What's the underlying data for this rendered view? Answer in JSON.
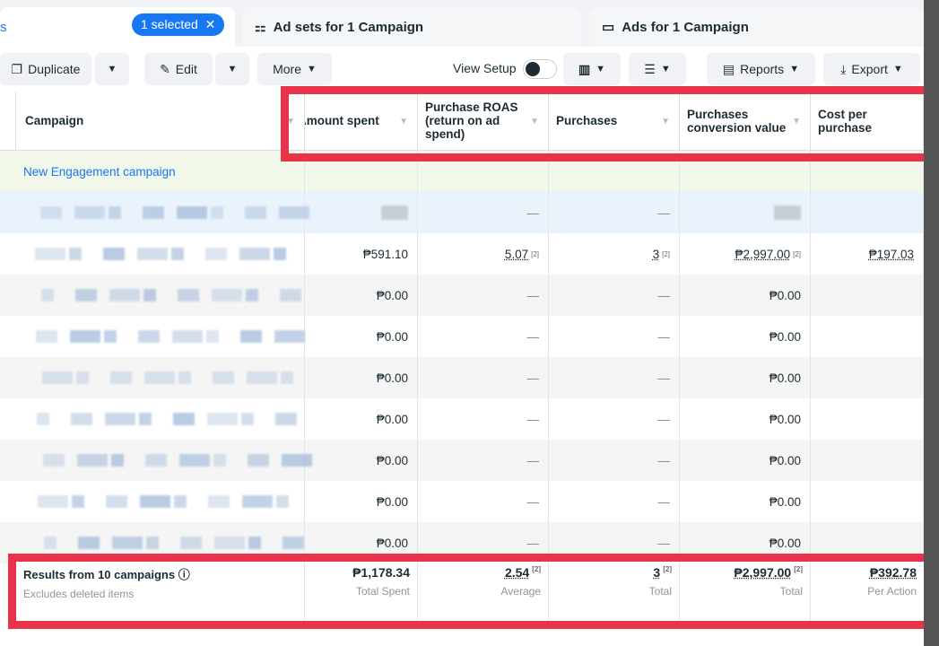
{
  "tabs": {
    "campaigns_partial": "s",
    "selected_label": "1 selected",
    "adsets": "Ad sets for 1 Campaign",
    "ads": "Ads for 1 Campaign"
  },
  "toolbar": {
    "duplicate": "Duplicate",
    "edit": "Edit",
    "more": "More",
    "view_setup": "View Setup",
    "reports": "Reports",
    "export": "Export"
  },
  "columns": [
    "Campaign",
    "Amount spent",
    "Purchase ROAS (return on ad spend)",
    "Purchases",
    "Purchases conversion value",
    "Cost per purchase"
  ],
  "rows": [
    {
      "name": "New Engagement campaign",
      "amount": "",
      "roas": "",
      "purchases": "",
      "value": "",
      "cost": ""
    },
    {
      "name": "",
      "amount": "",
      "roas": "—",
      "purchases": "—",
      "value": "",
      "cost": ""
    },
    {
      "name": "",
      "amount": "₱591.10",
      "roas": "5.07",
      "purchases": "3",
      "value": "₱2,997.00",
      "cost": "₱197.03"
    },
    {
      "name": "",
      "amount": "₱0.00",
      "roas": "—",
      "purchases": "—",
      "value": "₱0.00",
      "cost": ""
    },
    {
      "name": "",
      "amount": "₱0.00",
      "roas": "—",
      "purchases": "—",
      "value": "₱0.00",
      "cost": ""
    },
    {
      "name": "",
      "amount": "₱0.00",
      "roas": "—",
      "purchases": "—",
      "value": "₱0.00",
      "cost": ""
    },
    {
      "name": "",
      "amount": "₱0.00",
      "roas": "—",
      "purchases": "—",
      "value": "₱0.00",
      "cost": ""
    },
    {
      "name": "",
      "amount": "₱0.00",
      "roas": "—",
      "purchases": "—",
      "value": "₱0.00",
      "cost": ""
    },
    {
      "name": "",
      "amount": "₱0.00",
      "roas": "—",
      "purchases": "—",
      "value": "₱0.00",
      "cost": ""
    },
    {
      "name": "",
      "amount": "₱0.00",
      "roas": "—",
      "purchases": "—",
      "value": "₱0.00",
      "cost": ""
    }
  ],
  "footnote": "[2]",
  "footer": {
    "title": "Results from 10 campaigns",
    "subtitle": "Excludes deleted items",
    "amount": "₱1,178.34",
    "amount_label": "Total Spent",
    "roas": "2.54",
    "roas_label": "Average",
    "purchases": "3",
    "purchases_label": "Total",
    "value": "₱2,997.00",
    "value_label": "Total",
    "cost": "₱392.78",
    "cost_label": "Per Action"
  },
  "colors": {
    "accent": "#1877f2",
    "highlight": "#e8334a"
  }
}
